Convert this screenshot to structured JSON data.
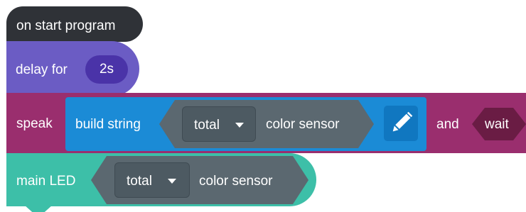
{
  "blocks": {
    "hat": {
      "label": "on start program",
      "color": "#2f3237"
    },
    "delay": {
      "label": "delay for",
      "value": "2s",
      "color": "#6b5cc4"
    },
    "speak": {
      "label": "speak",
      "build_string": {
        "label": "build string",
        "item": {
          "dropdown_value": "total",
          "sensor_label": "color sensor"
        },
        "edit_icon": "pencil-icon"
      },
      "and_label": "and",
      "wait_label": "wait",
      "color": "#9a2e6e"
    },
    "main_led": {
      "label": "main LED",
      "item": {
        "dropdown_value": "total",
        "sensor_label": "color sensor"
      },
      "color": "#3dbfa8"
    }
  }
}
